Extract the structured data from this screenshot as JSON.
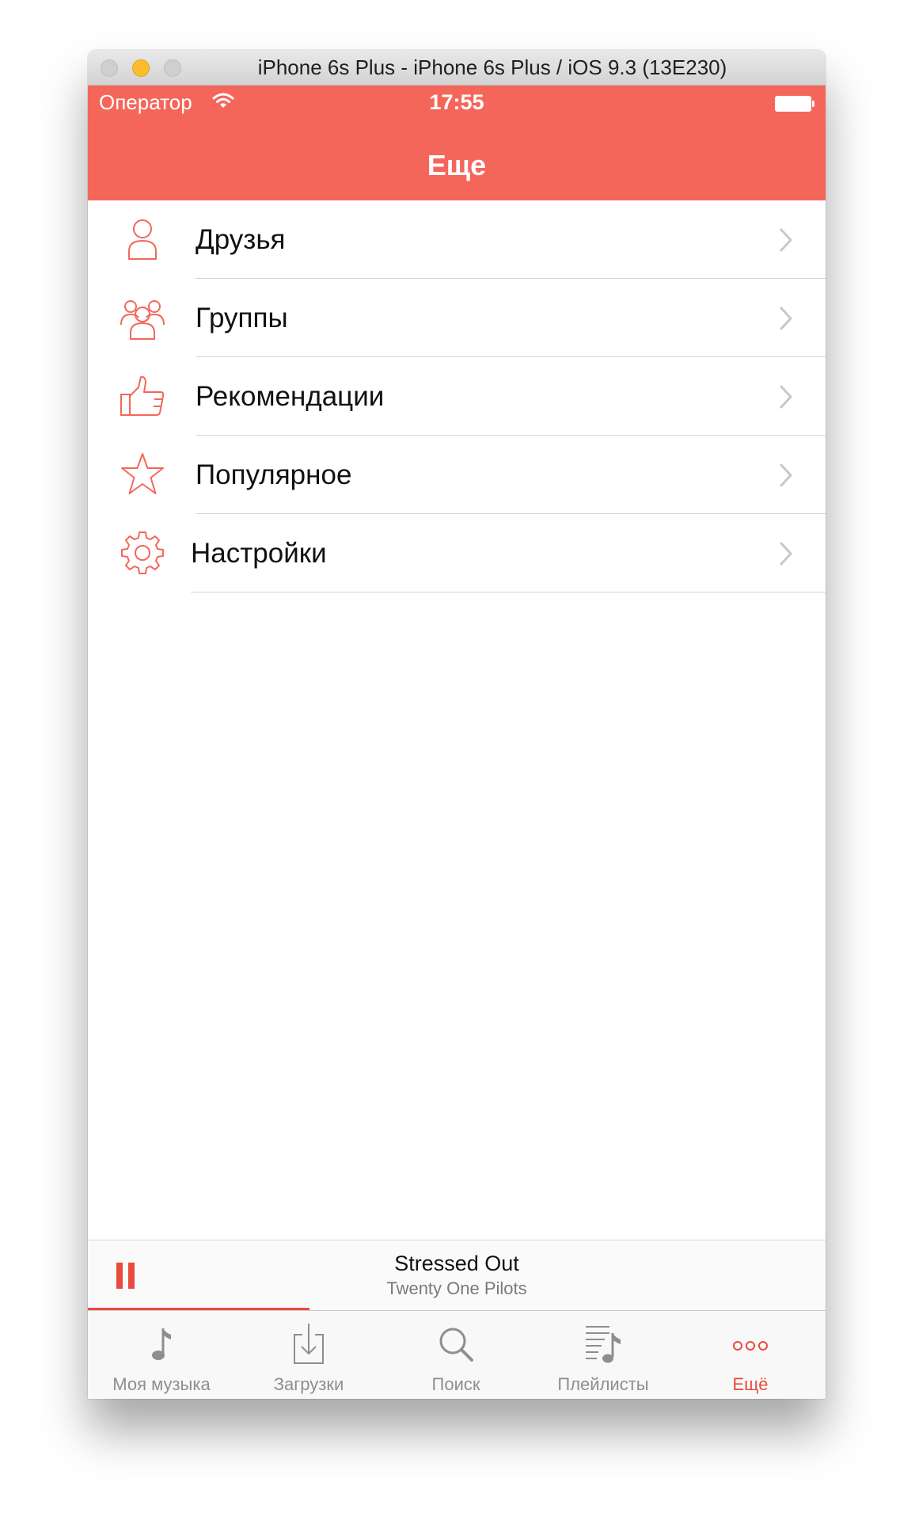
{
  "window": {
    "title": "iPhone 6s Plus - iPhone 6s Plus / iOS 9.3 (13E230)"
  },
  "status_bar": {
    "carrier": "Оператор",
    "time": "17:55"
  },
  "navbar": {
    "title": "Еще"
  },
  "menu": {
    "items": [
      {
        "label": "Друзья",
        "icon": "person-icon"
      },
      {
        "label": "Группы",
        "icon": "group-icon"
      },
      {
        "label": "Рекомендации",
        "icon": "thumbs-up-icon"
      },
      {
        "label": "Популярное",
        "icon": "star-icon"
      },
      {
        "label": "Настройки",
        "icon": "gear-icon"
      }
    ]
  },
  "player": {
    "song": "Stressed Out",
    "artist": "Twenty One Pilots",
    "progress": 0.3
  },
  "tabbar": {
    "tabs": [
      {
        "label": "Моя музыка",
        "icon": "music-note-icon"
      },
      {
        "label": "Загрузки",
        "icon": "download-icon"
      },
      {
        "label": "Поиск",
        "icon": "search-icon"
      },
      {
        "label": "Плейлисты",
        "icon": "playlist-icon"
      },
      {
        "label": "Ещё",
        "icon": "more-icon"
      }
    ],
    "active_index": 4
  },
  "colors": {
    "accent": "#f5665a",
    "active": "#e94b3c",
    "inactive": "#8e8e8e"
  }
}
